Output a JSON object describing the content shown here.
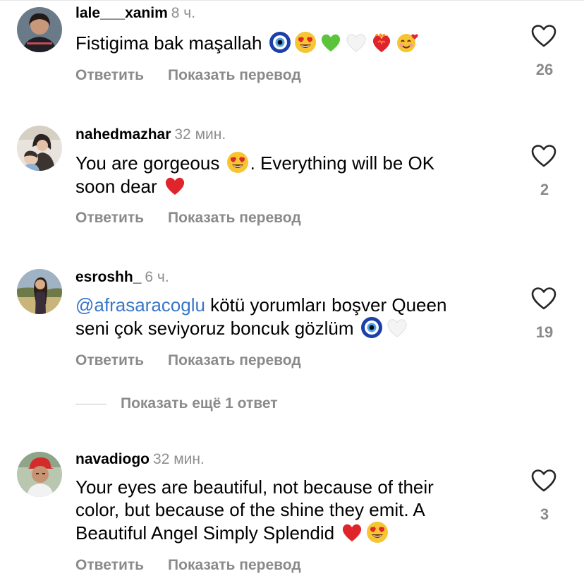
{
  "comments": [
    {
      "username": "lale___xanim",
      "time": "8 ч.",
      "text_before_emoji": "Fistigima bak maşallah",
      "emojis": [
        "nazar-emoji",
        "heart-eyes-emoji",
        "green-heart-emoji",
        "white-heart-emoji",
        "heart-on-fire-emoji",
        "smiling-hearts-emoji"
      ],
      "reply_label": "Ответить",
      "translate_label": "Показать перевод",
      "likes": "26"
    },
    {
      "username": "nahedmazhar",
      "time": "32 мин.",
      "text_part1": "You are gorgeous",
      "text_part2": ". Everything will be OK",
      "text_part3": "soon dear",
      "reply_label": "Ответить",
      "translate_label": "Показать перевод",
      "likes": "2"
    },
    {
      "username": "esroshh_",
      "time": "6 ч.",
      "mention": "@afrasaracoglu",
      "text_part1": " kötü yorumları boşver Queen",
      "text_part2": "seni çok seviyoruz boncuk gözlüm",
      "reply_label": "Ответить",
      "translate_label": "Показать перевод",
      "likes": "19"
    },
    {
      "username": "navadiogo",
      "time": "32 мин.",
      "line1": "Your eyes are beautiful, not because of their",
      "line2": "color, but because of the shine they emit. A",
      "line3": "Beautiful Angel Simply Splendid",
      "reply_label": "Ответить",
      "translate_label": "Показать перевод",
      "likes": "3"
    }
  ],
  "more_replies_label": "Показать ещё 1 ответ",
  "colors": {
    "mention": "#3a76c9",
    "secondary_text": "#8a8a8a",
    "heart_red": "#e0242b"
  }
}
